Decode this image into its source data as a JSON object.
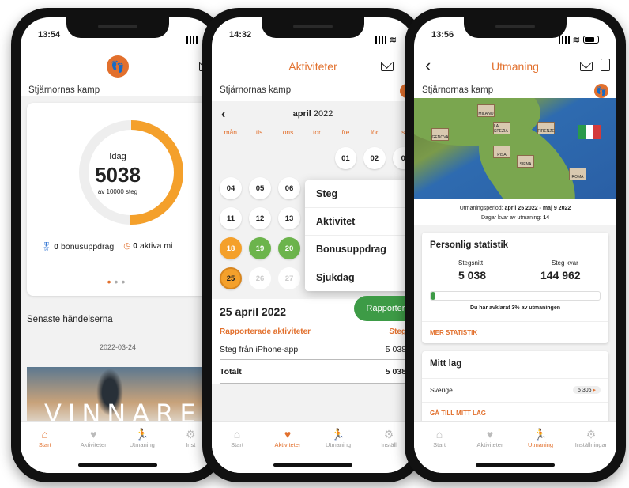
{
  "phones": [
    {
      "time": "13:54",
      "subtitle": "Stjärnornas kamp",
      "ring": {
        "label": "Idag",
        "value": "5038",
        "sub": "av 10000 steg",
        "progress": 0.5038
      },
      "bonus": {
        "count": "0",
        "label": "bonusuppdrag"
      },
      "missions": {
        "count": "0",
        "label": "aktiva mi"
      },
      "section_title": "Senaste händelserna",
      "event_date": "2022-03-24",
      "banner_text": "VINNARE",
      "tabs": [
        "Start",
        "Aktiviteter",
        "Utmaning",
        "Inst"
      ]
    },
    {
      "time": "14:32",
      "title": "Aktiviteter",
      "subtitle": "Stjärnornas kamp",
      "month": "april",
      "year": "2022",
      "weekdays": [
        "mån",
        "tis",
        "ons",
        "tor",
        "fre",
        "lör",
        "s"
      ],
      "weeks": [
        [
          "",
          "",
          "",
          "",
          "01",
          "02",
          "0"
        ],
        [
          "04",
          "05",
          "06",
          "",
          "",
          "",
          ""
        ],
        [
          "11",
          "12",
          "13",
          "",
          "",
          "",
          ""
        ],
        [
          "18",
          "19",
          "20",
          "",
          "",
          "",
          ""
        ],
        [
          "25",
          "26",
          "27",
          "",
          "",
          "",
          ""
        ]
      ],
      "menu": [
        "Steg",
        "Aktivitet",
        "Bonusuppdrag",
        "Sjukdag"
      ],
      "report_button": "Rapporter",
      "date_heading": "25 april 2022",
      "col_reported": "Rapporterade aktiviteter",
      "col_steps": "Steg",
      "activity_name": "Steg från iPhone-app",
      "activity_value": "5 038",
      "total_label": "Totalt",
      "total_value": "5 038",
      "tabs": [
        "Start",
        "Aktiviteter",
        "Utmaning",
        "Inställ"
      ]
    },
    {
      "time": "13:56",
      "title": "Utmaning",
      "subtitle": "Stjärnornas kamp",
      "map_cities": [
        "MILANO",
        "GENOVA",
        "LA SPEZIA",
        "FIRENZE",
        "PISA",
        "SIENA",
        "ROMA"
      ],
      "period_label": "Utmaningsperiod:",
      "period_value": "april 25 2022 - maj 9 2022",
      "days_left_label": "Dagar kvar av utmaning:",
      "days_left_value": "14",
      "stats_title": "Personlig statistik",
      "avg_label": "Stegsnitt",
      "avg_value": "5 038",
      "left_label": "Steg kvar",
      "left_value": "144 962",
      "progress_pct": 3,
      "progress_text": "Du har avklarat 3% av utmaningen",
      "more_stats": "MER STATISTIK",
      "team_title": "Mitt lag",
      "team_name": "Sverige",
      "team_steps": "5 306",
      "team_link": "GÅ TILL MITT LAG",
      "tabs": [
        "Start",
        "Aktiviteter",
        "Utmaning",
        "Inställningar"
      ]
    }
  ],
  "colors": {
    "accent": "#e2702d",
    "green": "#3d9b46",
    "orange": "#f4a02b"
  }
}
